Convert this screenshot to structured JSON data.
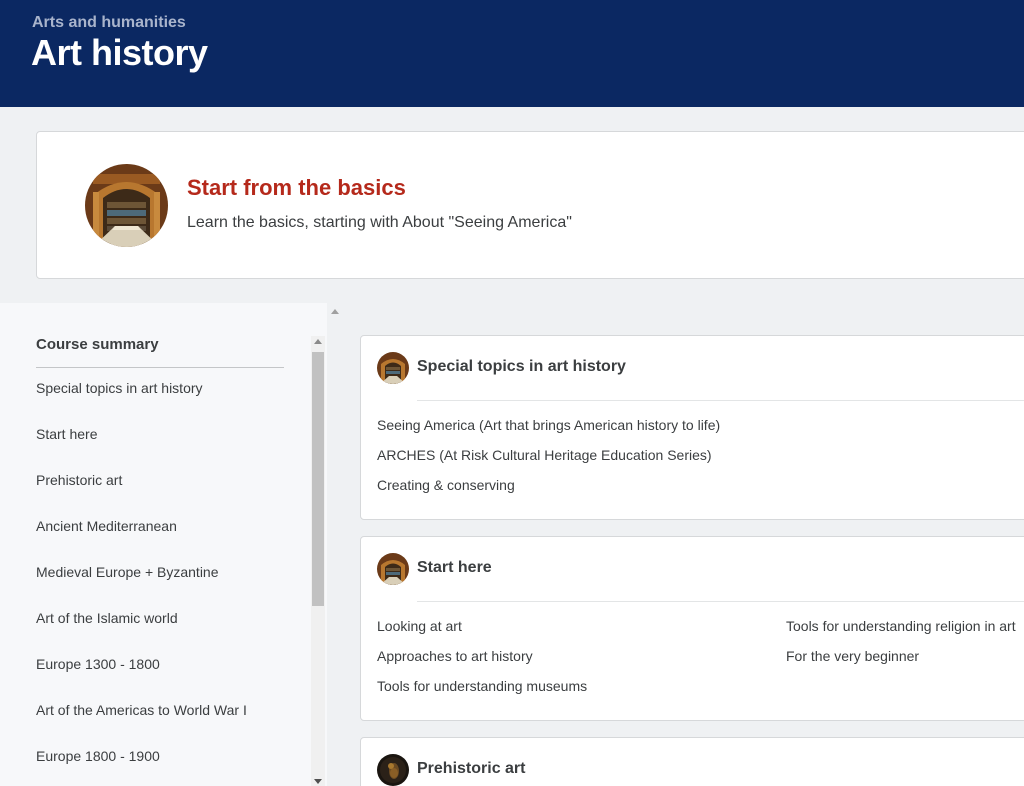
{
  "header": {
    "domain": "Arts and humanities",
    "title": "Art history",
    "background": "#0b2862"
  },
  "promo": {
    "heading": "Start from the basics",
    "subtitle": "Learn the basics, starting with About \"Seeing America\"",
    "accent": "#b5291b",
    "thumbnail_icon": "library-hall-image"
  },
  "sidebar": {
    "title": "Course summary",
    "items": [
      "Special topics in art history",
      "Start here",
      "Prehistoric art",
      "Ancient Mediterranean",
      "Medieval Europe + Byzantine",
      "Art of the Islamic world",
      "Europe 1300 - 1800",
      "Art of the Americas to World War I",
      "Europe 1800 - 1900"
    ]
  },
  "cards": [
    {
      "title": "Special topics in art history",
      "icon": "library-hall-image",
      "col1": [
        "Seeing America (Art that brings American history to life)",
        "ARCHES (At Risk Cultural Heritage Education Series)",
        "Creating & conserving"
      ],
      "col2": []
    },
    {
      "title": "Start here",
      "icon": "library-hall-image",
      "col1": [
        "Looking at art",
        "Approaches to art history",
        "Tools for understanding museums"
      ],
      "col2": [
        "Tools for understanding religion in art",
        "For the very beginner"
      ]
    },
    {
      "title": "Prehistoric art",
      "icon": "prehistoric-figure-image",
      "col1": [],
      "col2": []
    }
  ]
}
